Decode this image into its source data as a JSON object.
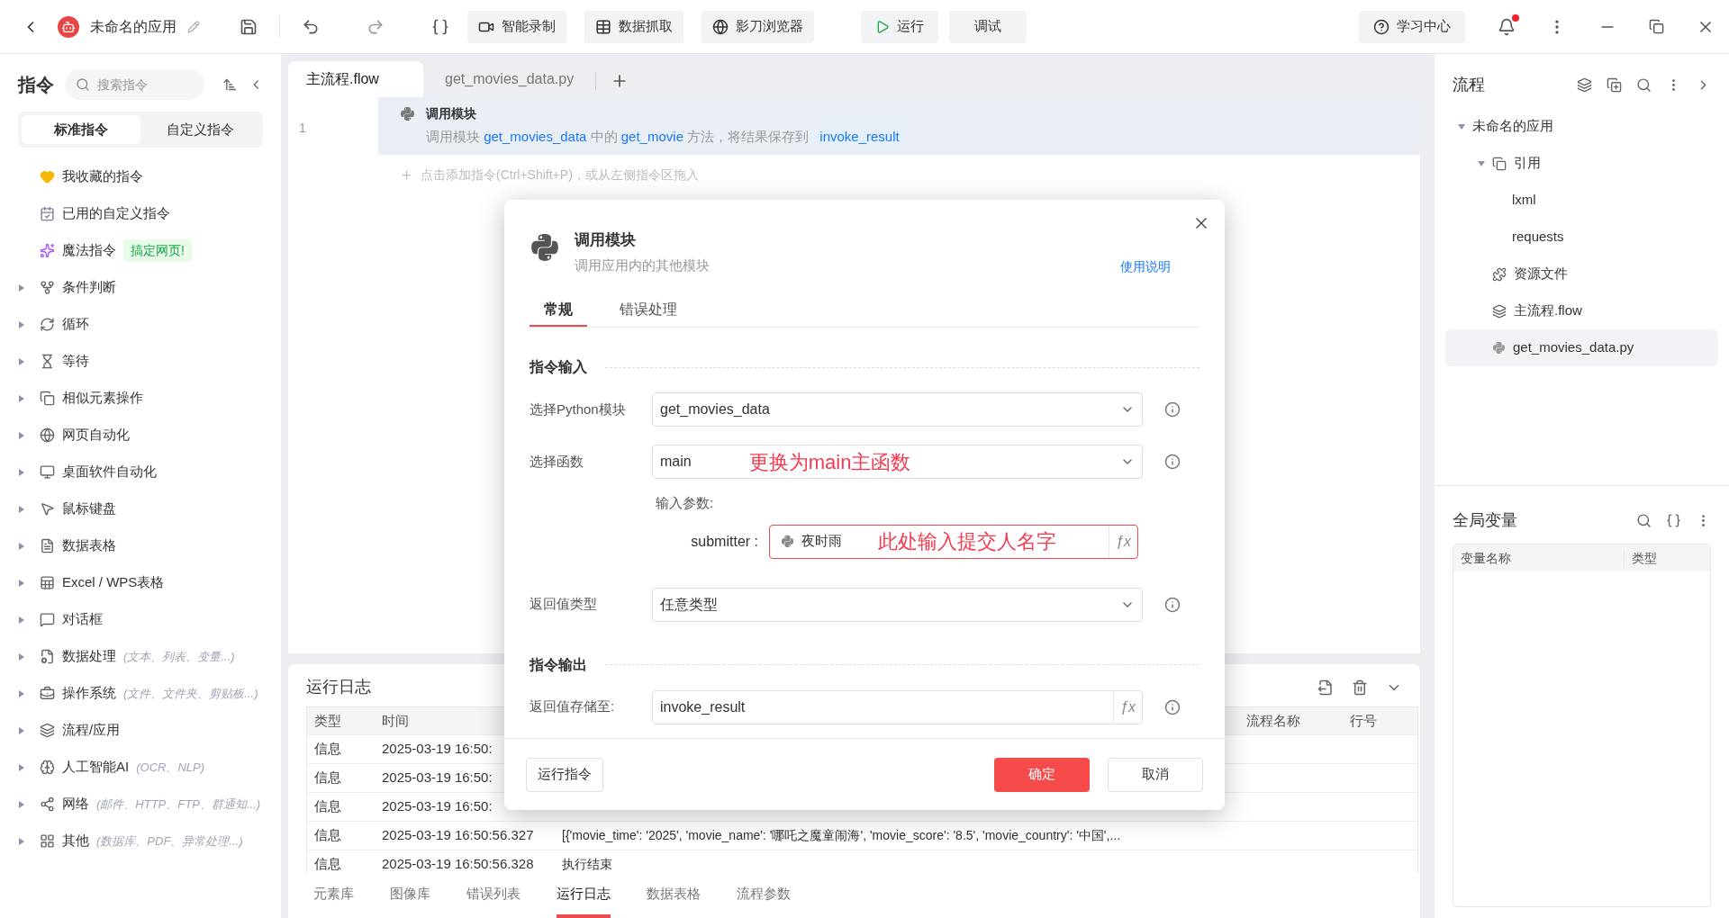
{
  "titlebar": {
    "app_name": "未命名的应用",
    "tools": [
      {
        "label": "智能录制"
      },
      {
        "label": "数据抓取"
      },
      {
        "label": "影刀浏览器"
      }
    ],
    "run": "运行",
    "debug": "调试",
    "learn": "学习中心",
    "notification_dot": true
  },
  "sidebar": {
    "title": "指令",
    "search_placeholder": "搜索指令",
    "tabs": [
      {
        "label": "标准指令",
        "selected": true
      },
      {
        "label": "自定义指令",
        "selected": false
      }
    ],
    "items": [
      {
        "label": "我收藏的指令",
        "expandable": false
      },
      {
        "label": "已用的自定义指令",
        "expandable": false
      },
      {
        "label": "魔法指令",
        "badge": "搞定网页!",
        "expandable": false
      },
      {
        "label": "条件判断",
        "expandable": true
      },
      {
        "label": "循环",
        "expandable": true
      },
      {
        "label": "等待",
        "expandable": true
      },
      {
        "label": "相似元素操作",
        "expandable": true
      },
      {
        "label": "网页自动化",
        "expandable": true
      },
      {
        "label": "桌面软件自动化",
        "expandable": true
      },
      {
        "label": "鼠标键盘",
        "expandable": true
      },
      {
        "label": "数据表格",
        "expandable": true
      },
      {
        "label": "Excel / WPS表格",
        "expandable": true
      },
      {
        "label": "对话框",
        "expandable": true
      },
      {
        "label": "数据处理",
        "hint": "(文本、列表、变量...)",
        "expandable": true
      },
      {
        "label": "操作系统",
        "hint": "(文件、文件夹、剪贴板...)",
        "expandable": true
      },
      {
        "label": "流程/应用",
        "expandable": true
      },
      {
        "label": "人工智能AI",
        "hint": "(OCR、NLP)",
        "expandable": true
      },
      {
        "label": "网络",
        "hint": "(邮件、HTTP、FTP、群通知...)",
        "expandable": true
      },
      {
        "label": "其他",
        "hint": "(数据库、PDF、异常处理...)",
        "expandable": true
      }
    ]
  },
  "editor": {
    "tabs": [
      {
        "label": "主流程.flow",
        "selected": true
      },
      {
        "label": "get_movies_data.py",
        "selected": false
      }
    ],
    "lines": [
      {
        "number": "1",
        "title": "调用模块",
        "segments": [
          {
            "text": "调用模块 ",
            "kind": "plain"
          },
          {
            "text": "get_movies_data",
            "kind": "code"
          },
          {
            "text": " 中的 ",
            "kind": "plain"
          },
          {
            "text": "get_movie",
            "kind": "code"
          },
          {
            "text": " 方法，将结果保存到 ",
            "kind": "plain"
          },
          {
            "text": "invoke_result",
            "kind": "variable"
          }
        ]
      }
    ],
    "add_hint": "点击添加指令(Ctrl+Shift+P)，或从左侧指令区拖入"
  },
  "log": {
    "title": "运行日志",
    "columns": [
      {
        "label": "类型"
      },
      {
        "label": "时间"
      },
      {
        "label": "流程名称"
      },
      {
        "label": "行号"
      }
    ],
    "rows": [
      {
        "type": "信息",
        "time": "2025-03-19 16:50:"
      },
      {
        "type": "信息",
        "time": "2025-03-19 16:50:"
      },
      {
        "type": "信息",
        "time": "2025-03-19 16:50:"
      },
      {
        "type": "信息",
        "time": "2025-03-19 16:50:56.327",
        "message": "[{'movie_time': '2025', 'movie_name': '哪吒之魔童闹海', 'movie_score': '8.5', 'movie_country': '中国',..."
      },
      {
        "type": "信息",
        "time": "2025-03-19 16:50:56.328",
        "message": "执行结束"
      }
    ]
  },
  "bottom_tabs": [
    {
      "label": "元素库",
      "selected": false
    },
    {
      "label": "图像库",
      "selected": false
    },
    {
      "label": "错误列表",
      "selected": false
    },
    {
      "label": "运行日志",
      "selected": true
    },
    {
      "label": "数据表格",
      "selected": false
    },
    {
      "label": "流程参数",
      "selected": false
    }
  ],
  "flow_panel": {
    "title": "流程",
    "tree": [
      {
        "label": "未命名的应用",
        "selected": false,
        "expanded": true,
        "children": [
          {
            "label": "引用",
            "selected": false,
            "expanded": true,
            "children": [
              {
                "label": "lxml",
                "selected": false
              },
              {
                "label": "requests",
                "selected": false
              }
            ]
          },
          {
            "label": "资源文件",
            "selected": false
          },
          {
            "label": "主流程.flow",
            "selected": false
          },
          {
            "label": "get_movies_data.py",
            "selected": true
          }
        ]
      }
    ]
  },
  "variables": {
    "title": "全局变量",
    "columns": [
      {
        "label": "变量名称"
      },
      {
        "label": "类型"
      }
    ]
  },
  "dialog": {
    "title": "调用模块",
    "subtitle": "调用应用内的其他模块",
    "help": "使用说明",
    "tabs": [
      {
        "label": "常规",
        "selected": true
      },
      {
        "label": "错误处理",
        "selected": false
      }
    ],
    "input_section": "指令输入",
    "fields": [
      {
        "kind": "select",
        "label": "选择Python模块",
        "value": "get_movies_data"
      },
      {
        "kind": "select",
        "label": "选择函数",
        "value": "main",
        "annotation": "更换为main主函数"
      },
      {
        "kind": "params",
        "label": "输入参数:",
        "params": [
          {
            "name": "submitter :",
            "value": "夜时雨",
            "annotation": "此处输入提交人名字",
            "fx": "ƒx"
          }
        ]
      },
      {
        "kind": "select",
        "label": "返回值类型",
        "value": "任意类型"
      }
    ],
    "output_section": "指令输出",
    "outputs": [
      {
        "kind": "variable",
        "label": "返回值存储至:",
        "value": "invoke_result",
        "fx": "ƒx"
      }
    ],
    "run_button": "运行指令",
    "ok_button": "确定",
    "cancel_button": "取消"
  }
}
